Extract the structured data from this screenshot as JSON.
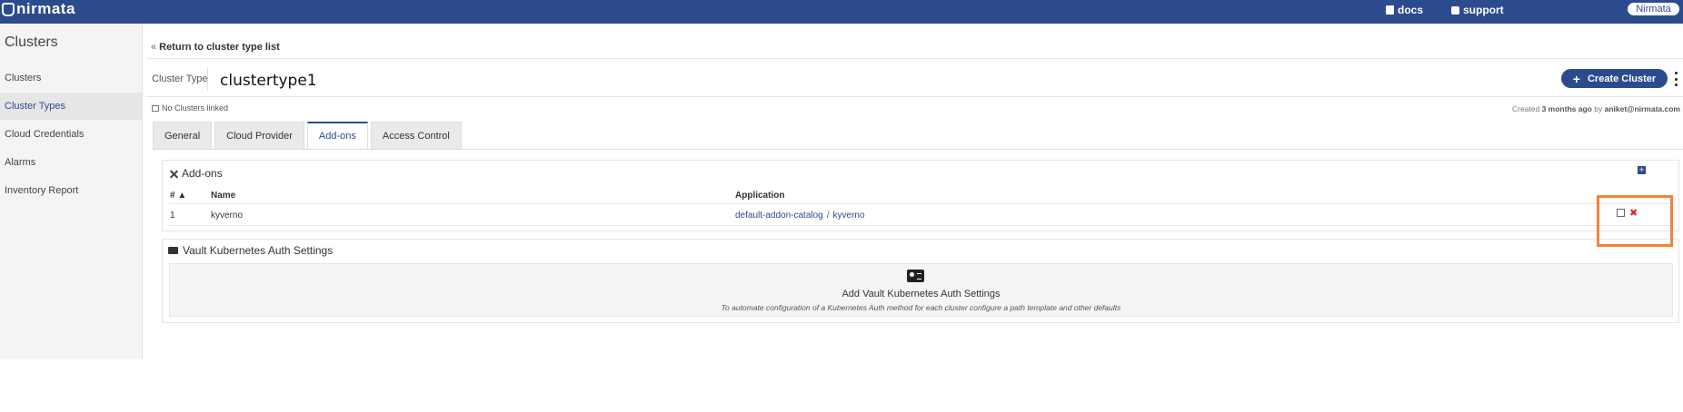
{
  "header": {
    "brand": "nirmata",
    "docs_label": "docs",
    "support_label": "support",
    "user_label": "Nirmata"
  },
  "sidebar": {
    "title": "Clusters",
    "items": [
      {
        "label": "Clusters"
      },
      {
        "label": "Cluster Types"
      },
      {
        "label": "Cloud Credentials"
      },
      {
        "label": "Alarms"
      },
      {
        "label": "Inventory Report"
      }
    ]
  },
  "main": {
    "breadcrumb": "Return to cluster type list",
    "cluster_type_label": "Cluster Type",
    "cluster_type_value": "clustertype1",
    "create_button": "Create Cluster",
    "no_clusters": "No Clusters linked",
    "created_prefix": "Created",
    "created_when": "3 months ago",
    "created_by_prefix": "by",
    "created_by": "aniket@nirmata.com",
    "tabs": [
      {
        "label": "General"
      },
      {
        "label": "Cloud Provider"
      },
      {
        "label": "Add-ons"
      },
      {
        "label": "Access Control"
      }
    ]
  },
  "addons": {
    "title": "Add-ons",
    "columns": {
      "index": "# ▲",
      "name": "Name",
      "application": "Application"
    },
    "rows": [
      {
        "index": "1",
        "name": "kyverno",
        "catalog": "default-addon-catalog",
        "separator": "/",
        "app": "kyverno"
      }
    ]
  },
  "vault": {
    "title": "Vault Kubernetes Auth Settings",
    "empty_title": "Add Vault Kubernetes Auth Settings",
    "empty_subtitle": "To automate configuration of a Kubernetes Auth method for each cluster configure a path template and other defaults"
  },
  "colors": {
    "primary": "#2c4b8f",
    "highlight": "#f0853a",
    "delete": "#d9261c"
  }
}
